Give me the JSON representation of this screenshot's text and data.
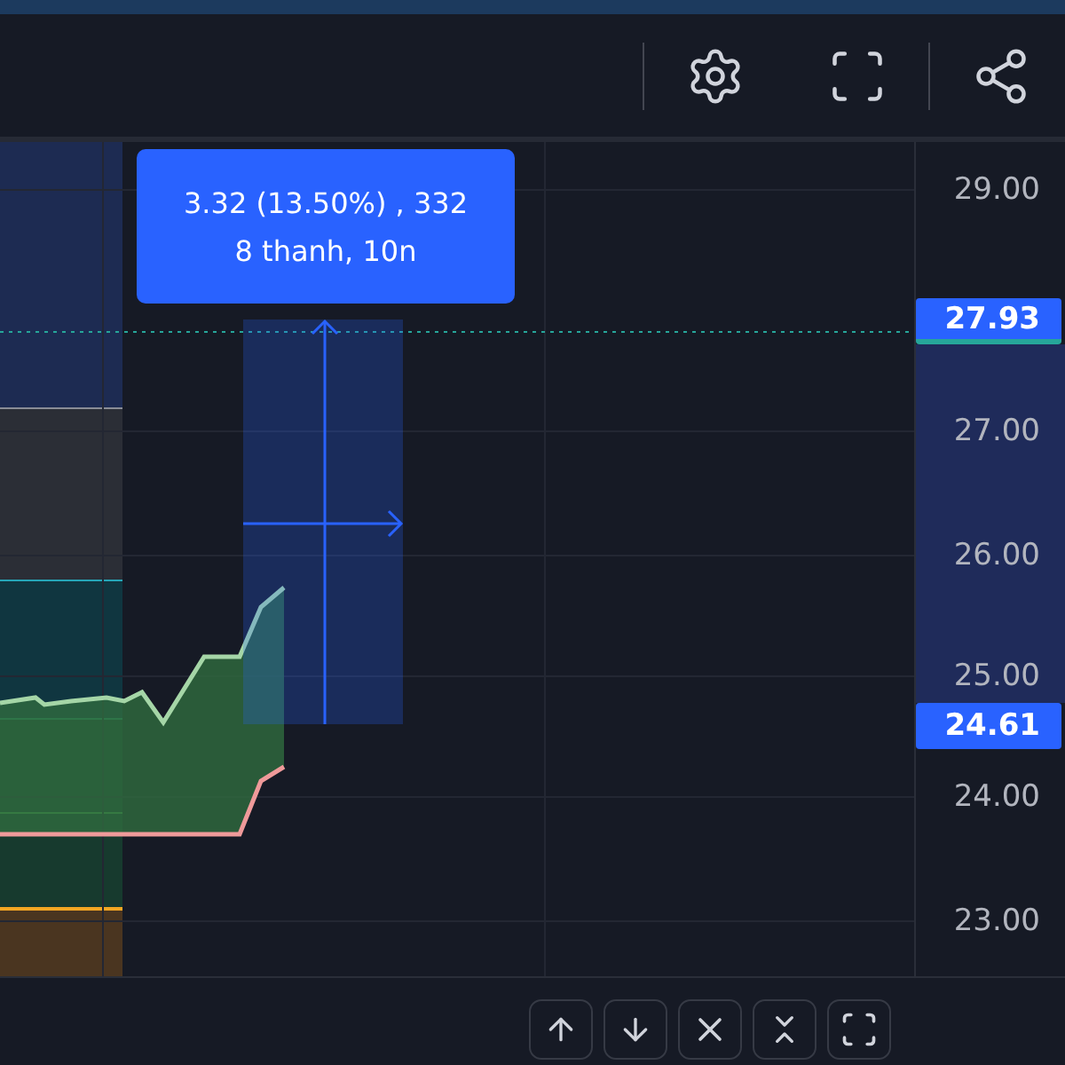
{
  "measure_tooltip": {
    "lines": [
      "3.32 (13.50%) , 332",
      "8 thanh, 10n"
    ]
  },
  "price_axis": [
    {
      "label": "29.00",
      "kind": "tick"
    },
    {
      "label": "27.93",
      "kind": "highlight"
    },
    {
      "label": "27.00",
      "kind": "tick"
    },
    {
      "label": "26.00",
      "kind": "tick"
    },
    {
      "label": "25.00",
      "kind": "tick"
    },
    {
      "label": "24.61",
      "kind": "highlight"
    },
    {
      "label": "24.00",
      "kind": "tick"
    },
    {
      "label": "23.00",
      "kind": "tick"
    }
  ]
}
